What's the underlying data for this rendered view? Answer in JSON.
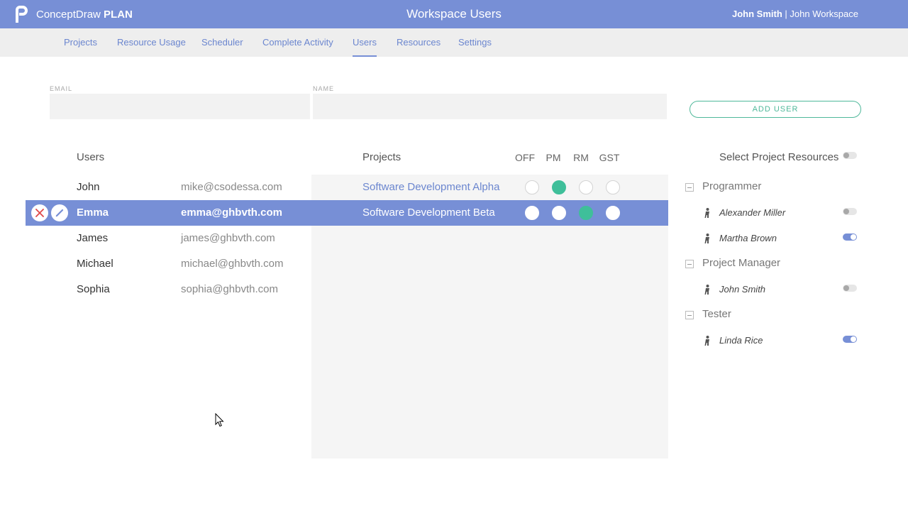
{
  "app": {
    "brand": "ConceptDraw",
    "brand_bold": "PLAN",
    "title": "Workspace Users"
  },
  "account": {
    "user": "John Smith",
    "separator": " | ",
    "workspace": "John Workspace"
  },
  "nav": [
    {
      "label": "Projects"
    },
    {
      "label": "Resource Usage"
    },
    {
      "label": "Scheduler"
    },
    {
      "label": "Complete Activity"
    },
    {
      "label": "Users",
      "active": true
    },
    {
      "label": "Resources"
    },
    {
      "label": "Settings"
    }
  ],
  "form": {
    "email_label": "EMAIL",
    "name_label": "NAME",
    "email_value": "",
    "name_value": "",
    "add_button": "ADD USER"
  },
  "table": {
    "users_header": "Users",
    "projects_header": "Projects",
    "roles": [
      "OFF",
      "PM",
      "RM",
      "GST"
    ],
    "rows": [
      {
        "name": "John",
        "email": "mike@csodessa.com",
        "project": "Software Development Alpha",
        "role": "PM"
      },
      {
        "name": "Emma",
        "email": "emma@ghbvth.com",
        "project": "Software Development Beta",
        "role": "RM",
        "selected": true
      },
      {
        "name": "James",
        "email": "james@ghbvth.com",
        "project": "",
        "role": ""
      },
      {
        "name": "Michael",
        "email": "michael@ghbvth.com",
        "project": "",
        "role": ""
      },
      {
        "name": "Sophia",
        "email": "sophia@ghbvth.com",
        "project": "",
        "role": ""
      }
    ]
  },
  "resources": {
    "title": "Select Project Resources",
    "select_all": false,
    "groups": [
      {
        "name": "Programmer",
        "items": [
          {
            "name": "Alexander Miller",
            "on": false
          },
          {
            "name": "Martha Brown",
            "on": true
          }
        ]
      },
      {
        "name": "Project Manager",
        "items": [
          {
            "name": "John Smith",
            "on": false
          }
        ]
      },
      {
        "name": "Tester",
        "items": [
          {
            "name": "Linda Rice",
            "on": true
          }
        ]
      }
    ]
  },
  "colors": {
    "accent": "#778fd6",
    "green": "#3fbf9a",
    "link": "#6b86cf",
    "delete": "#e04848"
  },
  "icons": [
    "conceptdraw-logo-icon",
    "delete-icon",
    "edit-icon",
    "person-icon",
    "collapse-icon",
    "mouse-cursor-icon"
  ]
}
